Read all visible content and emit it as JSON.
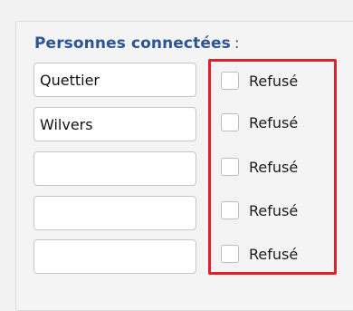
{
  "section": {
    "title": "Personnes connectées",
    "colon": ":"
  },
  "rows": [
    {
      "name": "Quettier",
      "refuse_label": "Refusé"
    },
    {
      "name": "Wilvers",
      "refuse_label": "Refusé"
    },
    {
      "name": "",
      "refuse_label": "Refusé"
    },
    {
      "name": "",
      "refuse_label": "Refusé"
    },
    {
      "name": "",
      "refuse_label": "Refusé"
    }
  ],
  "colors": {
    "title": "#2c5596",
    "highlight_border": "#e0202a"
  }
}
